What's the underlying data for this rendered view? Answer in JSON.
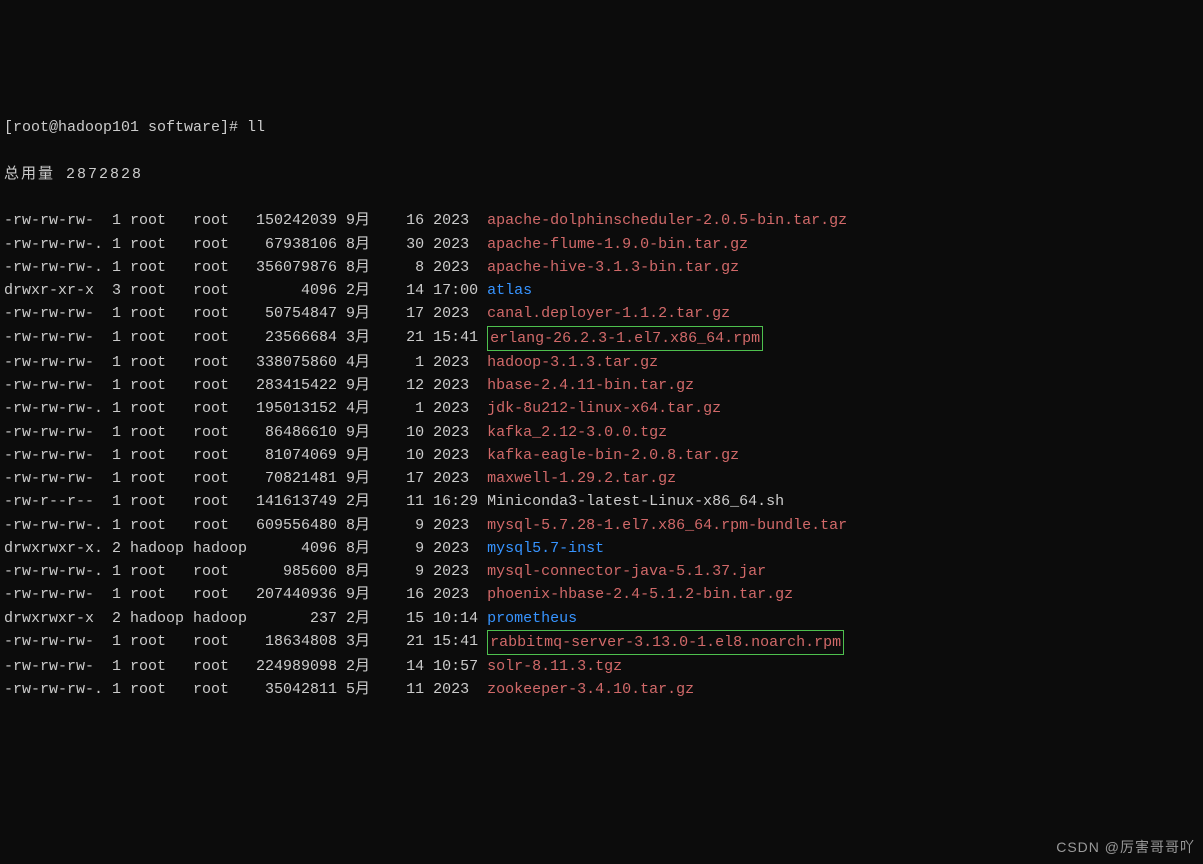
{
  "prompt_line": "[root@hadoop101 software]# ll",
  "total_label": "总用量 2872828",
  "watermark": "CSDN @厉害哥哥吖",
  "rows": [
    {
      "perm": "-rw-rw-rw-",
      "dot": " ",
      "links": "1",
      "owner": "root",
      "group": "root",
      "size": "150242039",
      "month": "9月",
      "day": "16",
      "time": "2023",
      "name": "apache-dolphinscheduler-2.0.5-bin.tar.gz",
      "cls": "file"
    },
    {
      "perm": "-rw-rw-rw-",
      "dot": ".",
      "links": "1",
      "owner": "root",
      "group": "root",
      "size": "67938106",
      "month": "8月",
      "day": "30",
      "time": "2023",
      "name": "apache-flume-1.9.0-bin.tar.gz",
      "cls": "file"
    },
    {
      "perm": "-rw-rw-rw-",
      "dot": ".",
      "links": "1",
      "owner": "root",
      "group": "root",
      "size": "356079876",
      "month": "8月",
      "day": "8",
      "time": "2023",
      "name": "apache-hive-3.1.3-bin.tar.gz",
      "cls": "file"
    },
    {
      "perm": "drwxr-xr-x",
      "dot": " ",
      "links": "3",
      "owner": "root",
      "group": "root",
      "size": "4096",
      "month": "2月",
      "day": "14",
      "time": "17:00",
      "name": "atlas",
      "cls": "dir"
    },
    {
      "perm": "-rw-rw-rw-",
      "dot": " ",
      "links": "1",
      "owner": "root",
      "group": "root",
      "size": "50754847",
      "month": "9月",
      "day": "17",
      "time": "2023",
      "name": "canal.deployer-1.1.2.tar.gz",
      "cls": "file"
    },
    {
      "perm": "-rw-rw-rw-",
      "dot": " ",
      "links": "1",
      "owner": "root",
      "group": "root",
      "size": "23566684",
      "month": "3月",
      "day": "21",
      "time": "15:41",
      "name": "erlang-26.2.3-1.el7.x86_64.rpm",
      "cls": "file",
      "boxed": true
    },
    {
      "perm": "-rw-rw-rw-",
      "dot": " ",
      "links": "1",
      "owner": "root",
      "group": "root",
      "size": "338075860",
      "month": "4月",
      "day": "1",
      "time": "2023",
      "name": "hadoop-3.1.3.tar.gz",
      "cls": "file"
    },
    {
      "perm": "-rw-rw-rw-",
      "dot": " ",
      "links": "1",
      "owner": "root",
      "group": "root",
      "size": "283415422",
      "month": "9月",
      "day": "12",
      "time": "2023",
      "name": "hbase-2.4.11-bin.tar.gz",
      "cls": "file"
    },
    {
      "perm": "-rw-rw-rw-",
      "dot": ".",
      "links": "1",
      "owner": "root",
      "group": "root",
      "size": "195013152",
      "month": "4月",
      "day": "1",
      "time": "2023",
      "name": "jdk-8u212-linux-x64.tar.gz",
      "cls": "file"
    },
    {
      "perm": "-rw-rw-rw-",
      "dot": " ",
      "links": "1",
      "owner": "root",
      "group": "root",
      "size": "86486610",
      "month": "9月",
      "day": "10",
      "time": "2023",
      "name": "kafka_2.12-3.0.0.tgz",
      "cls": "file"
    },
    {
      "perm": "-rw-rw-rw-",
      "dot": " ",
      "links": "1",
      "owner": "root",
      "group": "root",
      "size": "81074069",
      "month": "9月",
      "day": "10",
      "time": "2023",
      "name": "kafka-eagle-bin-2.0.8.tar.gz",
      "cls": "file"
    },
    {
      "perm": "-rw-rw-rw-",
      "dot": " ",
      "links": "1",
      "owner": "root",
      "group": "root",
      "size": "70821481",
      "month": "9月",
      "day": "17",
      "time": "2023",
      "name": "maxwell-1.29.2.tar.gz",
      "cls": "file"
    },
    {
      "perm": "-rw-r--r--",
      "dot": " ",
      "links": "1",
      "owner": "root",
      "group": "root",
      "size": "141613749",
      "month": "2月",
      "day": "11",
      "time": "16:29",
      "name": "Miniconda3-latest-Linux-x86_64.sh",
      "cls": "normal"
    },
    {
      "perm": "-rw-rw-rw-",
      "dot": ".",
      "links": "1",
      "owner": "root",
      "group": "root",
      "size": "609556480",
      "month": "8月",
      "day": "9",
      "time": "2023",
      "name": "mysql-5.7.28-1.el7.x86_64.rpm-bundle.tar",
      "cls": "file"
    },
    {
      "perm": "drwxrwxr-x",
      "dot": ".",
      "links": "2",
      "owner": "hadoop",
      "group": "hadoop",
      "size": "4096",
      "month": "8月",
      "day": "9",
      "time": "2023",
      "name": "mysql5.7-inst",
      "cls": "dir"
    },
    {
      "perm": "-rw-rw-rw-",
      "dot": ".",
      "links": "1",
      "owner": "root",
      "group": "root",
      "size": "985600",
      "month": "8月",
      "day": "9",
      "time": "2023",
      "name": "mysql-connector-java-5.1.37.jar",
      "cls": "file"
    },
    {
      "perm": "-rw-rw-rw-",
      "dot": " ",
      "links": "1",
      "owner": "root",
      "group": "root",
      "size": "207440936",
      "month": "9月",
      "day": "16",
      "time": "2023",
      "name": "phoenix-hbase-2.4-5.1.2-bin.tar.gz",
      "cls": "file"
    },
    {
      "perm": "drwxrwxr-x",
      "dot": " ",
      "links": "2",
      "owner": "hadoop",
      "group": "hadoop",
      "size": "237",
      "month": "2月",
      "day": "15",
      "time": "10:14",
      "name": "prometheus",
      "cls": "dir"
    },
    {
      "perm": "-rw-rw-rw-",
      "dot": " ",
      "links": "1",
      "owner": "root",
      "group": "root",
      "size": "18634808",
      "month": "3月",
      "day": "21",
      "time": "15:41",
      "name": "rabbitmq-server-3.13.0-1.el8.noarch.rpm",
      "cls": "file",
      "boxed": true
    },
    {
      "perm": "-rw-rw-rw-",
      "dot": " ",
      "links": "1",
      "owner": "root",
      "group": "root",
      "size": "224989098",
      "month": "2月",
      "day": "14",
      "time": "10:57",
      "name": "solr-8.11.3.tgz",
      "cls": "file"
    },
    {
      "perm": "-rw-rw-rw-",
      "dot": ".",
      "links": "1",
      "owner": "root",
      "group": "root",
      "size": "35042811",
      "month": "5月",
      "day": "11",
      "time": "2023",
      "name": "zookeeper-3.4.10.tar.gz",
      "cls": "file"
    }
  ]
}
